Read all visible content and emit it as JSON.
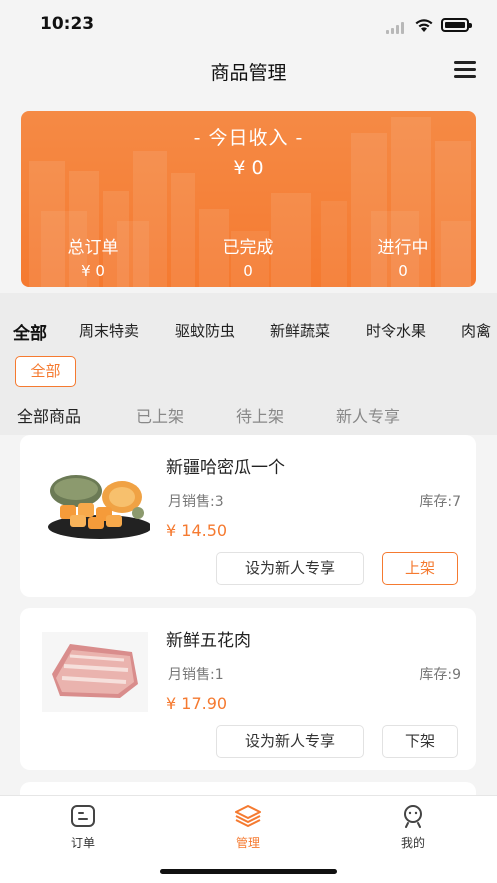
{
  "status_bar": {
    "time": "10:23"
  },
  "header": {
    "title": "商品管理"
  },
  "income_card": {
    "title": "- 今日收入 -",
    "value": "¥ 0",
    "stats": [
      {
        "label": "总订单",
        "value": "¥ 0"
      },
      {
        "label": "已完成",
        "value": "0"
      },
      {
        "label": "进行中",
        "value": "0"
      }
    ]
  },
  "categories": {
    "items": [
      "全部",
      "周末特卖",
      "驱蚊防虫",
      "新鲜蔬菜",
      "时令水果",
      "肉禽"
    ],
    "selected_sub": "全部"
  },
  "status_tabs": [
    "全部商品",
    "已上架",
    "待上架",
    "新人专享"
  ],
  "products": [
    {
      "name": "新疆哈密瓜一个",
      "sales": "月销售:3",
      "stock": "库存:7",
      "price": "¥ 14.50",
      "btn_newuser": "设为新人专享",
      "btn_shelf": "上架"
    },
    {
      "name": "新鲜五花肉",
      "sales": "月销售:1",
      "stock": "库存:9",
      "price": "¥ 17.90",
      "btn_newuser": "设为新人专享",
      "btn_shelf": "下架"
    }
  ],
  "tab_bar": [
    {
      "label": "订单",
      "icon": "order-icon"
    },
    {
      "label": "管理",
      "icon": "layers-icon"
    },
    {
      "label": "我的",
      "icon": "profile-icon"
    }
  ],
  "colors": {
    "accent": "#f57a30",
    "background": "#f4f4f4"
  }
}
